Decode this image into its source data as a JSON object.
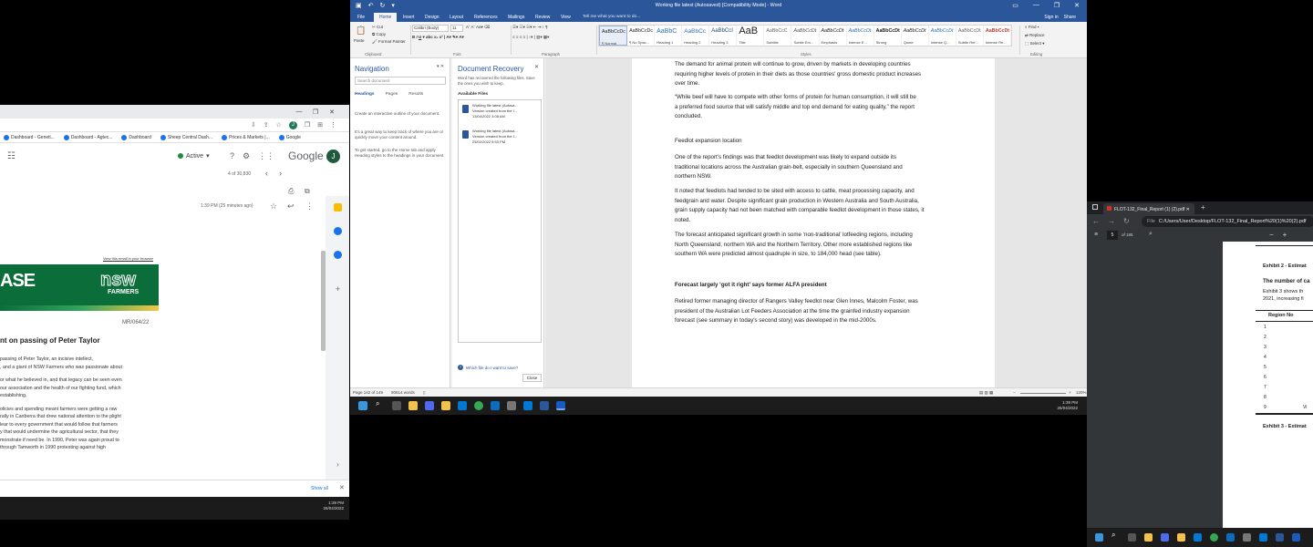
{
  "chrome": {
    "window_controls": [
      "—",
      "❐",
      "✕"
    ],
    "toolbar_icons": [
      "⇩",
      "⇪",
      "☆",
      "J",
      "❒",
      "⊞",
      "⋮"
    ],
    "bookmarks": [
      "Dashboard - Geneti...",
      "Dashboard - Agtec...",
      "Dashboard",
      "Sheep Central Dash...",
      "Prices & Markets |...",
      "Google"
    ],
    "gmail": {
      "filter_icon": "☷",
      "status": "Active",
      "logo": "Google",
      "avatar": "J",
      "count": "4 of 30,830",
      "time": "1:39 PM (25 minutes ago)",
      "banner_link": "View this email in your browser",
      "banner_left": "ASE",
      "banner_logo_top": "nsw",
      "banner_logo_bottom": "FARMERS",
      "ref": "MR/064/22",
      "heading": "nt on passing of Peter Taylor",
      "body_lines": [
        "passing of Peter Taylor, an incisive intellect,",
        ", and a giant of NSW Farmers who was passionate about",
        "or what he believed in, and that legacy can be seen even",
        " our association and the health of our fighting fund, which",
        "establishing.",
        "olicies and spending meant farmers were getting a raw",
        "rally in Canberra that drew national attention to the plight",
        "lear to every government that would follow that farmers",
        "y that would undermine the agricultural sector, that they",
        "monstrate if need be. In 1990, Peter was again proud to",
        " through Tamworth in 1990 protesting against high"
      ]
    },
    "download_show_all": "Show all",
    "clock_time": "1:39 PM",
    "clock_date": "26/04/2022"
  },
  "word": {
    "title": "Working file latest (Autosaved) [Compatibility Mode] - Word",
    "menu": [
      "File",
      "Home",
      "Insert",
      "Design",
      "Layout",
      "References",
      "Mailings",
      "Review",
      "View"
    ],
    "tell_me": "Tell me what you want to do...",
    "sign_in": "Sign in",
    "share": "Share",
    "ribbon": {
      "cut": "Cut",
      "copy": "Copy",
      "paste": "Paste",
      "format_painter": "Format Painter",
      "font_name": "Calibri (Body)",
      "font_size": "11",
      "groups": [
        "Clipboard",
        "Font",
        "Paragraph",
        "Styles",
        "Editing"
      ],
      "find": "Find",
      "replace": "Replace",
      "select": "Select",
      "styles": [
        {
          "preview": "AaBbCcDc",
          "name": "¶ Normal"
        },
        {
          "preview": "AaBbCcDc",
          "name": "¶ No Spac..."
        },
        {
          "preview": "AaBbC",
          "name": "Heading 1"
        },
        {
          "preview": "AaBbCc",
          "name": "Heading 2"
        },
        {
          "preview": "AaBbCcI",
          "name": "Heading 3"
        },
        {
          "preview": "AaB",
          "name": "Title"
        },
        {
          "preview": "AaBbCcC",
          "name": "Subtitle"
        },
        {
          "preview": "AaBbCcDt",
          "name": "Subtle Em..."
        },
        {
          "preview": "AaBbCcDt",
          "name": "Emphasis"
        },
        {
          "preview": "AaBbCcDt",
          "name": "Intense E..."
        },
        {
          "preview": "AaBbCcDt",
          "name": "Strong"
        },
        {
          "preview": "AaBbCcDt",
          "name": "Quote"
        },
        {
          "preview": "AaBbCcDt",
          "name": "Intense Q..."
        },
        {
          "preview": "AaBbCcDt",
          "name": "Subtle Ref..."
        },
        {
          "preview": "AaBbCcDt",
          "name": "Intense Re..."
        }
      ]
    },
    "navigation": {
      "title": "Navigation",
      "search_placeholder": "Search document",
      "tabs": [
        "Headings",
        "Pages",
        "Results"
      ],
      "hint1": "Create an interactive outline of your document.",
      "hint2": "It's a great way to keep track of where you are or quickly move your content around.",
      "hint3": "To get started, go to the Home tab and apply Heading styles to the headings in your document."
    },
    "recovery": {
      "title": "Document Recovery",
      "desc": "Word has recovered the following files. Save the ones you wish to keep.",
      "available": "Available Files",
      "files": [
        {
          "name": "Working file latest (Autosa...",
          "line2": "Version created from the l...",
          "line3": "13/04/2022 3:08 AM"
        },
        {
          "name": "Working file latest (Autosa...",
          "line2": "Version created from the l...",
          "line3": "25/02/2022 5:53 PM"
        }
      ],
      "which": "Which file do I want to save?",
      "close": "Close"
    },
    "document": {
      "p1": [
        "The demand for animal protein will continue to grow, driven by markets in developing countries",
        "requiring higher levels of protein in their diets as those countries' gross domestic product increases",
        "over time."
      ],
      "p2": [
        "“While beef will have to compete with other forms of protein for human consumption, it will still be",
        "a preferred food source that will satisfy middle and top end demand for eating quality,” the report",
        "concluded."
      ],
      "h1": "Feedlot expansion location",
      "p3": [
        "One of the report's findings was that feedlot development was likely to expand outside its",
        "traditional locations across the Australian grain-belt, especially in southern Queensland and",
        "northern NSW."
      ],
      "p4": [
        "It noted that  feedlots had tended to be sited with access to cattle, meat processing capacity, and",
        "feedgrain and water. Despite significant grain production in Western Australia and South Australia,",
        "grain supply capacity had not been matched with comparable feedlot development in those states, it",
        "noted."
      ],
      "p5": [
        "The forecast anticipated significant growth in some ‘non-traditional’ lotfeeding regions, including",
        "North Queensland, northern WA and the Northern Territory. Other more established regions like",
        "southern WA were predicted almost quadruple in size, to 184,000 head (see table)."
      ],
      "h2": "Forecast largely ‘got it right’ says former ALFA president",
      "p6": [
        "Retired former managing director of Rangers Valley feedlot near Glen Innes, Malcolm Foster, was",
        "president of the Australian Lot Feeders Association at the time the grainfed industry expansion",
        "forecast (see summary in today's second story) was developed in the mid-2000s."
      ]
    },
    "status": {
      "page": "Page 142 of 149",
      "words": "90614 words",
      "zoom": "120%"
    },
    "clock_time": "1:39 PM",
    "clock_date": "26/04/2022"
  },
  "pdf": {
    "tab_title": "FLOT-132_Final_Report (1) (2).pdf",
    "address_label": "File",
    "address": "C:/Users/User/Desktop/FLOT-132_Final_Report%20(1)%20(2).pdf",
    "page_num": "5",
    "page_total": "of 185",
    "exhibit2": "Exhibit 2 - Estimat",
    "subhead": "The number of ca",
    "line1": "Exhibit 3 shows th",
    "line2": "2021, increasing fi",
    "col_header": "Region No",
    "rows": [
      "1",
      "2",
      "3",
      "4",
      "5",
      "6",
      "7",
      "8",
      "9"
    ],
    "row9_extra": "Vi",
    "exhibit3": "Exhibit 3 - Estimat"
  },
  "colors": {
    "word_blue": "#2b579a",
    "nsw_green": "#0b6e3a"
  }
}
